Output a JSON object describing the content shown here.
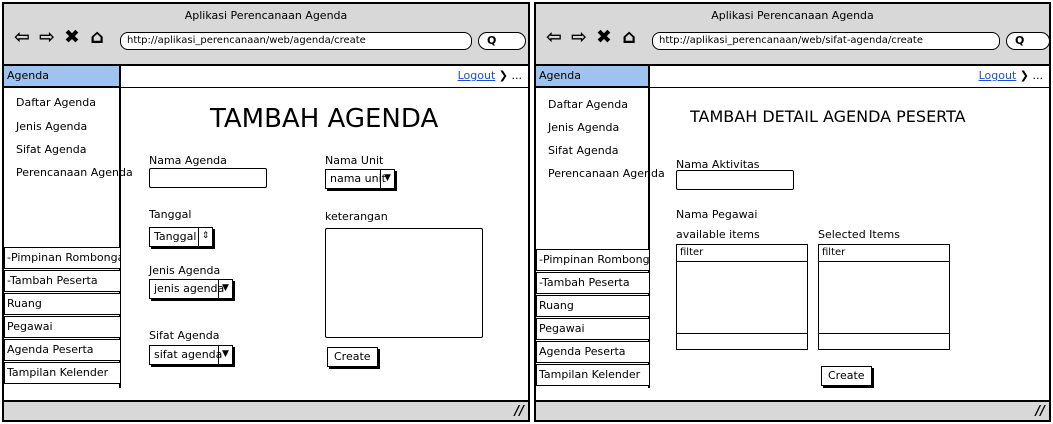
{
  "left": {
    "window_title": "Aplikasi Perencanaan Agenda",
    "url": "http://aplikasi_perencanaan/web/agenda/create",
    "search_glyph": "Q",
    "sidebar_active": "Agenda",
    "sub_items": [
      "Daftar Agenda",
      "Jenis Agenda",
      "Sifat Agenda",
      "Perencanaan Agenda"
    ],
    "menu_items": [
      "-Pimpinan Rombongan",
      "-Tambah Peserta",
      "Ruang",
      "Pegawai",
      "Agenda Peserta",
      "Tampilan Kelender"
    ],
    "logout": "Logout",
    "logout_suffix": "❯ ...",
    "heading": "TAMBAH AGENDA",
    "form": {
      "nama_agenda_label": "Nama Agenda",
      "nama_unit_label": "Nama Unit",
      "nama_unit_value": "nama unit",
      "tanggal_label": "Tanggal",
      "tanggal_value": "Tanggal",
      "keterangan_label": "keterangan",
      "jenis_agenda_label": "Jenis Agenda",
      "jenis_agenda_value": "jenis agenda",
      "sifat_agenda_label": "Sifat Agenda",
      "sifat_agenda_value": "sifat agenda",
      "create_label": "Create"
    }
  },
  "right": {
    "window_title": "Aplikasi Perencanaan Agenda",
    "url": "http://aplikasi_perencanaan/web/sifat-agenda/create",
    "search_glyph": "Q",
    "sidebar_active": "Agenda",
    "sub_items": [
      "Daftar Agenda",
      "Jenis Agenda",
      "Sifat Agenda",
      "Perencanaan Agenda"
    ],
    "menu_items": [
      "-Pimpinan Rombongan",
      "-Tambah Peserta",
      "Ruang",
      "Pegawai",
      "Agenda Peserta",
      "Tampilan Kelender"
    ],
    "logout": "Logout",
    "logout_suffix": "❯ ...",
    "heading": "TAMBAH DETAIL AGENDA PESERTA",
    "form": {
      "nama_aktivitas_label": "Nama Aktivitas",
      "nama_pegawai_label": "Nama Pegawai",
      "available_label": "available items",
      "selected_label": "Selected Items",
      "filter_available": "filter",
      "filter_selected": "filter",
      "create_label": "Create"
    }
  },
  "icons": {
    "back": "⇦",
    "forward": "⇨",
    "close": "✖",
    "home": "⌂",
    "grip": "//"
  }
}
